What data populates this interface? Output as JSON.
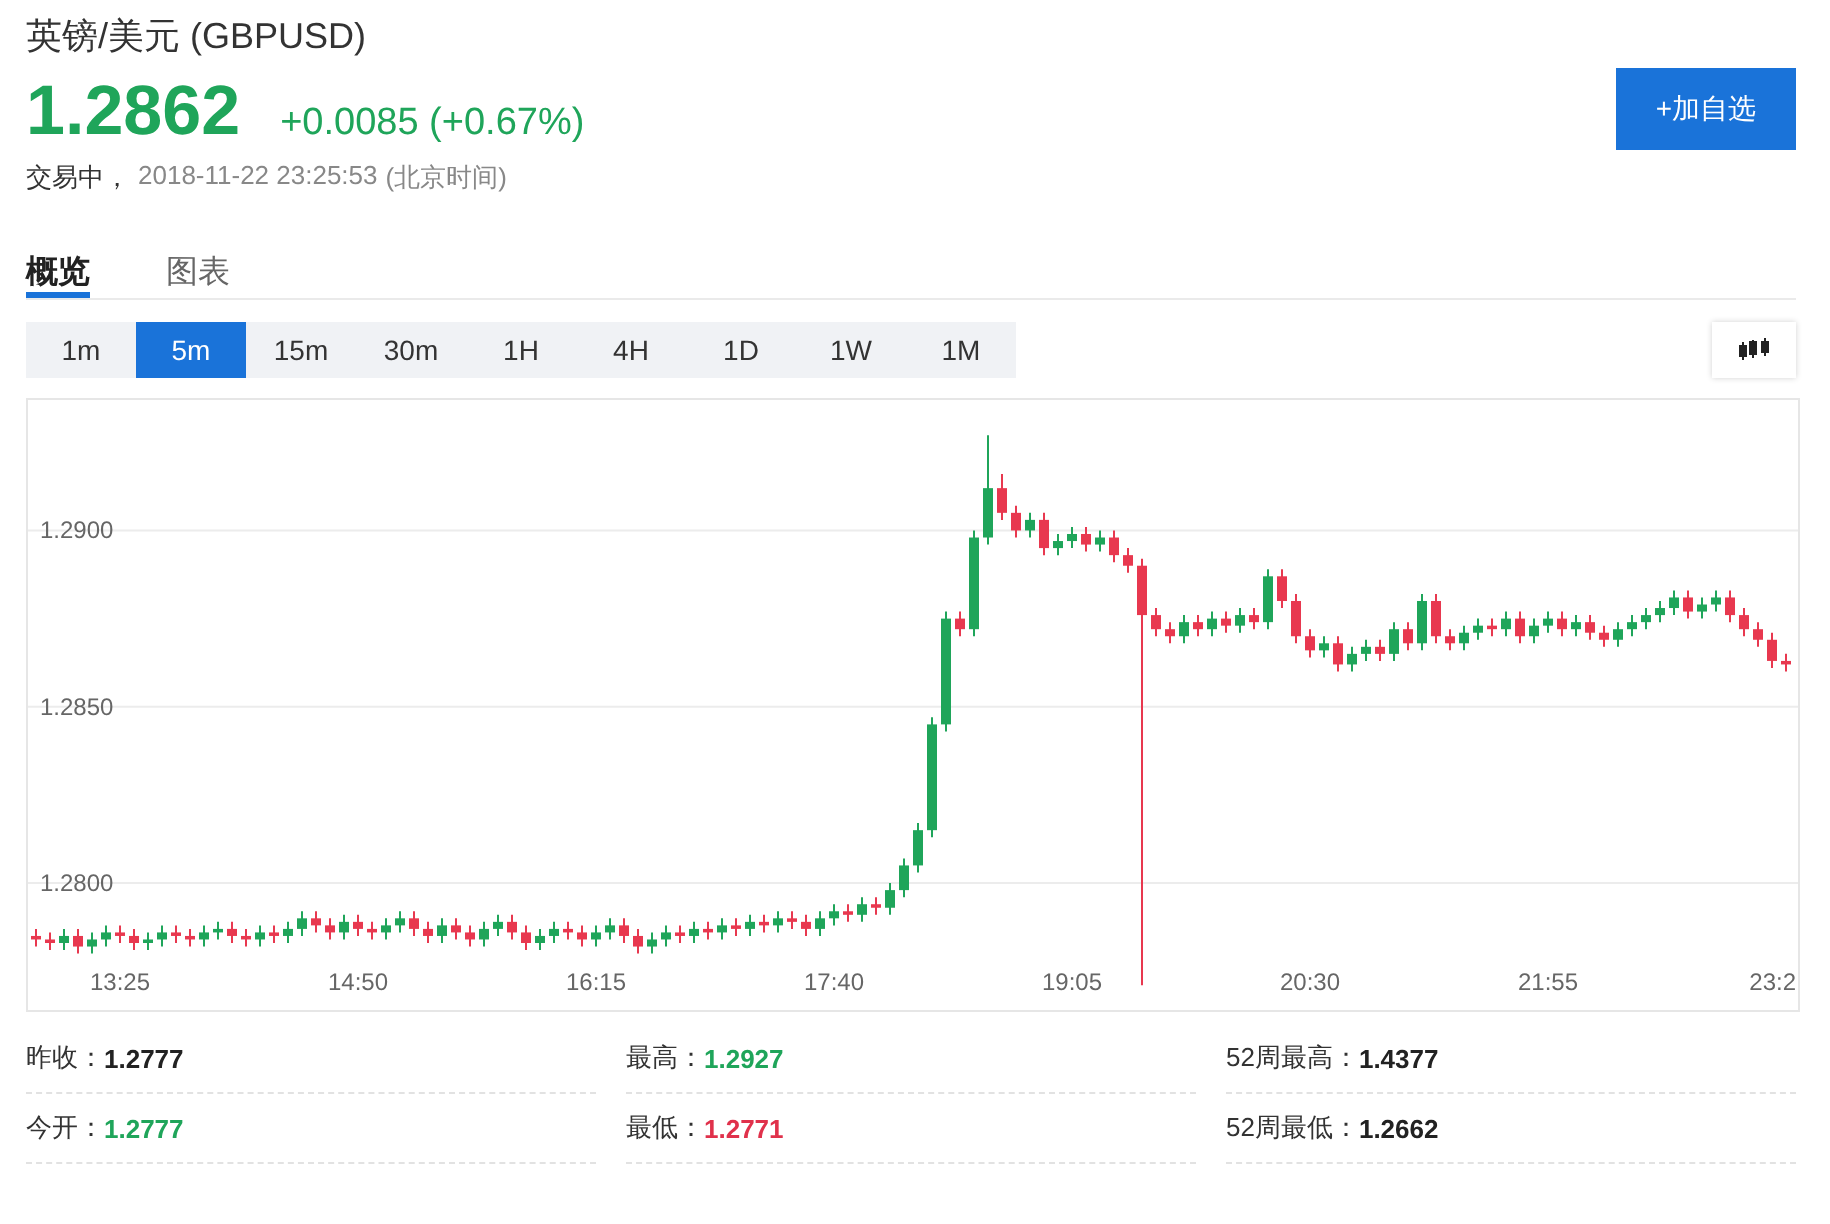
{
  "header": {
    "title": "英镑/美元 (GBPUSD)",
    "price": "1.2862",
    "change": "+0.0085 (+0.67%)",
    "status": "交易中，",
    "timestamp": "2018-11-22 23:25:53",
    "timezone": "(北京时间)",
    "add_button": "+加自选"
  },
  "tabs": [
    {
      "label": "概览",
      "selected": true
    },
    {
      "label": "图表",
      "selected": false
    }
  ],
  "periods": [
    {
      "label": "1m",
      "selected": false
    },
    {
      "label": "5m",
      "selected": true
    },
    {
      "label": "15m",
      "selected": false
    },
    {
      "label": "30m",
      "selected": false
    },
    {
      "label": "1H",
      "selected": false
    },
    {
      "label": "4H",
      "selected": false
    },
    {
      "label": "1D",
      "selected": false
    },
    {
      "label": "1W",
      "selected": false
    },
    {
      "label": "1M",
      "selected": false
    }
  ],
  "chart": {
    "chart_data": {
      "type": "candlestick",
      "grid": true,
      "ylim": [
        1.2764,
        1.2937
      ],
      "yticks": [
        {
          "value": 1.28,
          "label": "1.2800"
        },
        {
          "value": 1.285,
          "label": "1.2850"
        },
        {
          "value": 1.29,
          "label": "1.2900"
        }
      ],
      "categories": [
        null,
        null,
        null,
        null,
        null,
        null,
        "13:25",
        null,
        null,
        null,
        null,
        null,
        null,
        null,
        null,
        null,
        null,
        null,
        null,
        null,
        null,
        null,
        null,
        "14:50",
        null,
        null,
        null,
        null,
        null,
        null,
        null,
        null,
        null,
        null,
        null,
        null,
        null,
        null,
        null,
        null,
        "16:15",
        null,
        null,
        null,
        null,
        null,
        null,
        null,
        null,
        null,
        null,
        null,
        null,
        null,
        null,
        null,
        null,
        "17:40",
        null,
        null,
        null,
        null,
        null,
        null,
        null,
        null,
        null,
        null,
        null,
        null,
        null,
        null,
        null,
        null,
        "19:05",
        null,
        null,
        null,
        null,
        null,
        null,
        null,
        null,
        null,
        null,
        null,
        null,
        null,
        null,
        null,
        null,
        "20:30",
        null,
        null,
        null,
        null,
        null,
        null,
        null,
        null,
        null,
        null,
        null,
        null,
        null,
        null,
        null,
        null,
        "21:55",
        null,
        null,
        null,
        null,
        null,
        null,
        null,
        null,
        null,
        null,
        null,
        null,
        null,
        null,
        null,
        null,
        "23:2"
      ],
      "ohlc": [
        [
          1.2785,
          1.2787,
          1.2782,
          1.2784
        ],
        [
          1.2784,
          1.2786,
          1.2781,
          1.2783
        ],
        [
          1.2783,
          1.2787,
          1.2781,
          1.2785
        ],
        [
          1.2785,
          1.2787,
          1.278,
          1.2782
        ],
        [
          1.2782,
          1.2786,
          1.278,
          1.2784
        ],
        [
          1.2784,
          1.2788,
          1.2782,
          1.2786
        ],
        [
          1.2786,
          1.2788,
          1.2783,
          1.2785
        ],
        [
          1.2785,
          1.2787,
          1.2781,
          1.2783
        ],
        [
          1.2783,
          1.2786,
          1.2781,
          1.2784
        ],
        [
          1.2784,
          1.2788,
          1.2782,
          1.2786
        ],
        [
          1.2786,
          1.2788,
          1.2783,
          1.2785
        ],
        [
          1.2785,
          1.2787,
          1.2782,
          1.2784
        ],
        [
          1.2784,
          1.2788,
          1.2782,
          1.2786
        ],
        [
          1.2786,
          1.2789,
          1.2784,
          1.2787
        ],
        [
          1.2787,
          1.2789,
          1.2783,
          1.2785
        ],
        [
          1.2785,
          1.2787,
          1.2782,
          1.2784
        ],
        [
          1.2784,
          1.2788,
          1.2782,
          1.2786
        ],
        [
          1.2786,
          1.2788,
          1.2783,
          1.2785
        ],
        [
          1.2785,
          1.2789,
          1.2783,
          1.2787
        ],
        [
          1.2787,
          1.2792,
          1.2785,
          1.279
        ],
        [
          1.279,
          1.2792,
          1.2786,
          1.2788
        ],
        [
          1.2788,
          1.279,
          1.2784,
          1.2786
        ],
        [
          1.2786,
          1.2791,
          1.2784,
          1.2789
        ],
        [
          1.2789,
          1.2791,
          1.2785,
          1.2787
        ],
        [
          1.2787,
          1.2789,
          1.2784,
          1.2786
        ],
        [
          1.2786,
          1.279,
          1.2784,
          1.2788
        ],
        [
          1.2788,
          1.2792,
          1.2786,
          1.279
        ],
        [
          1.279,
          1.2792,
          1.2785,
          1.2787
        ],
        [
          1.2787,
          1.2789,
          1.2783,
          1.2785
        ],
        [
          1.2785,
          1.279,
          1.2783,
          1.2788
        ],
        [
          1.2788,
          1.279,
          1.2784,
          1.2786
        ],
        [
          1.2786,
          1.2788,
          1.2782,
          1.2784
        ],
        [
          1.2784,
          1.2789,
          1.2782,
          1.2787
        ],
        [
          1.2787,
          1.2791,
          1.2785,
          1.2789
        ],
        [
          1.2789,
          1.2791,
          1.2784,
          1.2786
        ],
        [
          1.2786,
          1.2788,
          1.2781,
          1.2783
        ],
        [
          1.2783,
          1.2787,
          1.2781,
          1.2785
        ],
        [
          1.2785,
          1.2789,
          1.2783,
          1.2787
        ],
        [
          1.2787,
          1.2789,
          1.2784,
          1.2786
        ],
        [
          1.2786,
          1.2788,
          1.2782,
          1.2784
        ],
        [
          1.2784,
          1.2788,
          1.2782,
          1.2786
        ],
        [
          1.2786,
          1.279,
          1.2784,
          1.2788
        ],
        [
          1.2788,
          1.279,
          1.2783,
          1.2785
        ],
        [
          1.2785,
          1.2787,
          1.278,
          1.2782
        ],
        [
          1.2782,
          1.2786,
          1.278,
          1.2784
        ],
        [
          1.2784,
          1.2788,
          1.2782,
          1.2786
        ],
        [
          1.2786,
          1.2788,
          1.2783,
          1.2785
        ],
        [
          1.2785,
          1.2789,
          1.2783,
          1.2787
        ],
        [
          1.2787,
          1.2789,
          1.2784,
          1.2786
        ],
        [
          1.2786,
          1.279,
          1.2784,
          1.2788
        ],
        [
          1.2788,
          1.279,
          1.2785,
          1.2787
        ],
        [
          1.2787,
          1.2791,
          1.2785,
          1.2789
        ],
        [
          1.2789,
          1.2791,
          1.2786,
          1.2788
        ],
        [
          1.2788,
          1.2792,
          1.2786,
          1.279
        ],
        [
          1.279,
          1.2792,
          1.2787,
          1.2789
        ],
        [
          1.2789,
          1.2791,
          1.2785,
          1.2787
        ],
        [
          1.2787,
          1.2792,
          1.2785,
          1.279
        ],
        [
          1.279,
          1.2794,
          1.2788,
          1.2792
        ],
        [
          1.2792,
          1.2794,
          1.2789,
          1.2791
        ],
        [
          1.2791,
          1.2796,
          1.2789,
          1.2794
        ],
        [
          1.2794,
          1.2796,
          1.2791,
          1.2793
        ],
        [
          1.2793,
          1.28,
          1.2791,
          1.2798
        ],
        [
          1.2798,
          1.2807,
          1.2796,
          1.2805
        ],
        [
          1.2805,
          1.2817,
          1.2803,
          1.2815
        ],
        [
          1.2815,
          1.2847,
          1.2813,
          1.2845
        ],
        [
          1.2845,
          1.2877,
          1.2843,
          1.2875
        ],
        [
          1.2875,
          1.2877,
          1.287,
          1.2872
        ],
        [
          1.2872,
          1.29,
          1.287,
          1.2898
        ],
        [
          1.2898,
          1.2927,
          1.2896,
          1.2912
        ],
        [
          1.2912,
          1.2916,
          1.2903,
          1.2905
        ],
        [
          1.2905,
          1.2907,
          1.2898,
          1.29
        ],
        [
          1.29,
          1.2905,
          1.2898,
          1.2903
        ],
        [
          1.2903,
          1.2905,
          1.2893,
          1.2895
        ],
        [
          1.2895,
          1.2899,
          1.2893,
          1.2897
        ],
        [
          1.2897,
          1.2901,
          1.2895,
          1.2899
        ],
        [
          1.2899,
          1.2901,
          1.2894,
          1.2896
        ],
        [
          1.2896,
          1.29,
          1.2894,
          1.2898
        ],
        [
          1.2898,
          1.29,
          1.2891,
          1.2893
        ],
        [
          1.2893,
          1.2895,
          1.2888,
          1.289
        ],
        [
          1.289,
          1.2892,
          1.2771,
          1.2876
        ],
        [
          1.2876,
          1.2878,
          1.287,
          1.2872
        ],
        [
          1.2872,
          1.2874,
          1.2868,
          1.287
        ],
        [
          1.287,
          1.2876,
          1.2868,
          1.2874
        ],
        [
          1.2874,
          1.2876,
          1.287,
          1.2872
        ],
        [
          1.2872,
          1.2877,
          1.287,
          1.2875
        ],
        [
          1.2875,
          1.2877,
          1.2871,
          1.2873
        ],
        [
          1.2873,
          1.2878,
          1.2871,
          1.2876
        ],
        [
          1.2876,
          1.2878,
          1.2872,
          1.2874
        ],
        [
          1.2874,
          1.2889,
          1.2872,
          1.2887
        ],
        [
          1.2887,
          1.2889,
          1.2878,
          1.288
        ],
        [
          1.288,
          1.2882,
          1.2868,
          1.287
        ],
        [
          1.287,
          1.2872,
          1.2864,
          1.2866
        ],
        [
          1.2866,
          1.287,
          1.2864,
          1.2868
        ],
        [
          1.2868,
          1.287,
          1.286,
          1.2862
        ],
        [
          1.2862,
          1.2867,
          1.286,
          1.2865
        ],
        [
          1.2865,
          1.2869,
          1.2863,
          1.2867
        ],
        [
          1.2867,
          1.2869,
          1.2863,
          1.2865
        ],
        [
          1.2865,
          1.2874,
          1.2863,
          1.2872
        ],
        [
          1.2872,
          1.2874,
          1.2866,
          1.2868
        ],
        [
          1.2868,
          1.2882,
          1.2866,
          1.288
        ],
        [
          1.288,
          1.2882,
          1.2868,
          1.287
        ],
        [
          1.287,
          1.2872,
          1.2866,
          1.2868
        ],
        [
          1.2868,
          1.2873,
          1.2866,
          1.2871
        ],
        [
          1.2871,
          1.2875,
          1.2869,
          1.2873
        ],
        [
          1.2873,
          1.2875,
          1.287,
          1.2872
        ],
        [
          1.2872,
          1.2877,
          1.287,
          1.2875
        ],
        [
          1.2875,
          1.2877,
          1.2868,
          1.287
        ],
        [
          1.287,
          1.2875,
          1.2868,
          1.2873
        ],
        [
          1.2873,
          1.2877,
          1.2871,
          1.2875
        ],
        [
          1.2875,
          1.2877,
          1.287,
          1.2872
        ],
        [
          1.2872,
          1.2876,
          1.287,
          1.2874
        ],
        [
          1.2874,
          1.2876,
          1.2869,
          1.2871
        ],
        [
          1.2871,
          1.2873,
          1.2867,
          1.2869
        ],
        [
          1.2869,
          1.2874,
          1.2867,
          1.2872
        ],
        [
          1.2872,
          1.2876,
          1.287,
          1.2874
        ],
        [
          1.2874,
          1.2878,
          1.2872,
          1.2876
        ],
        [
          1.2876,
          1.288,
          1.2874,
          1.2878
        ],
        [
          1.2878,
          1.2883,
          1.2876,
          1.2881
        ],
        [
          1.2881,
          1.2883,
          1.2875,
          1.2877
        ],
        [
          1.2877,
          1.2881,
          1.2875,
          1.2879
        ],
        [
          1.2879,
          1.2883,
          1.2877,
          1.2881
        ],
        [
          1.2881,
          1.2883,
          1.2874,
          1.2876
        ],
        [
          1.2876,
          1.2878,
          1.287,
          1.2872
        ],
        [
          1.2872,
          1.2874,
          1.2867,
          1.2869
        ],
        [
          1.2869,
          1.2871,
          1.2861,
          1.2863
        ],
        [
          1.2863,
          1.2865,
          1.286,
          1.2862
        ]
      ]
    }
  },
  "stats": [
    {
      "label": "昨收：",
      "value": "1.2777",
      "color": "#222222"
    },
    {
      "label": "最高：",
      "value": "1.2927",
      "color": "#1fa55a"
    },
    {
      "label": "52周最高：",
      "value": "1.4377",
      "color": "#222222"
    },
    {
      "label": "今开：",
      "value": "1.2777",
      "color": "#1fa55a"
    },
    {
      "label": "最低：",
      "value": "1.2771",
      "color": "#e0314b"
    },
    {
      "label": "52周最低：",
      "value": "1.2662",
      "color": "#222222"
    }
  ]
}
